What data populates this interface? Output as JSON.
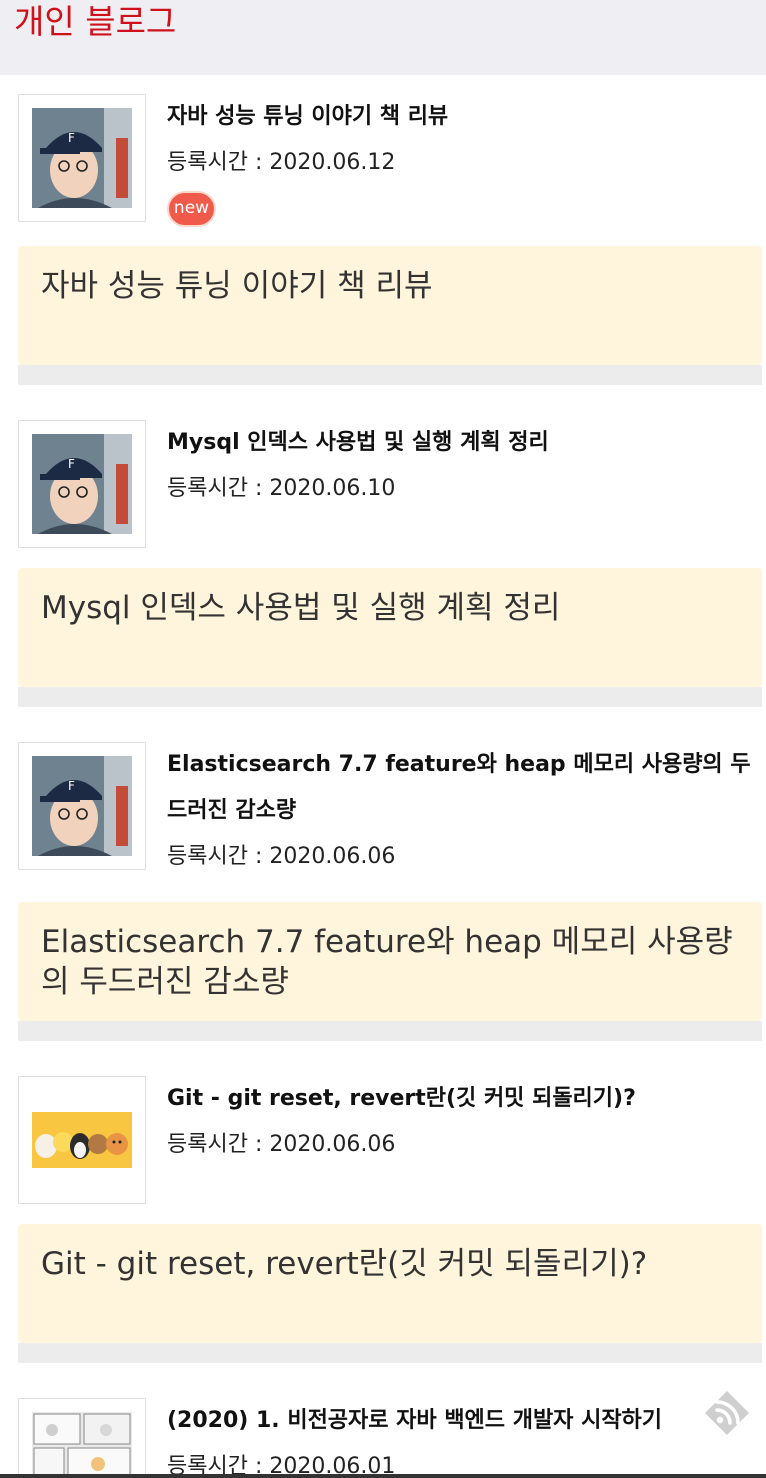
{
  "header": {
    "title": "개인 블로그"
  },
  "posts": [
    {
      "title": "자바 성능 튜닝 이야기 책 리뷰",
      "date": "등록시간 : 2020.06.12",
      "badge": "new",
      "summary": "자바 성능 튜닝 이야기 책 리뷰",
      "thumbnail": "author-photo"
    },
    {
      "title": "Mysql 인덱스 사용법 및 실행 계획 정리",
      "date": "등록시간 : 2020.06.10",
      "summary": "Mysql 인덱스 사용법 및 실행 계획 정리",
      "thumbnail": "author-photo"
    },
    {
      "title": "Elasticsearch 7.7 feature와 heap 메모리 사용량의 두드러진 감소량",
      "date": "등록시간 : 2020.06.06",
      "summary": "Elasticsearch 7.7 feature와 heap 메모리 사용량의 두드러진 감소량",
      "thumbnail": "author-photo"
    },
    {
      "title": "Git - git reset, revert란(깃 커밋 되돌리기)?",
      "date": "등록시간 : 2020.06.06",
      "summary": "Git - git reset, revert란(깃 커밋 되돌리기)?",
      "thumbnail": "kakao-friends-illustration"
    },
    {
      "title": "(2020) 1. 비전공자로 자바 백엔드 개발자 시작하기",
      "date": "등록시간 : 2020.06.01",
      "thumbnail": "comic-strip"
    }
  ],
  "fab": {
    "icon": "rss-feed-icon"
  },
  "colors": {
    "title_red": "#d0101a",
    "summary_bg": "#fff4dc",
    "badge_red": "#f05a4a",
    "divider_gray": "#ececec"
  }
}
